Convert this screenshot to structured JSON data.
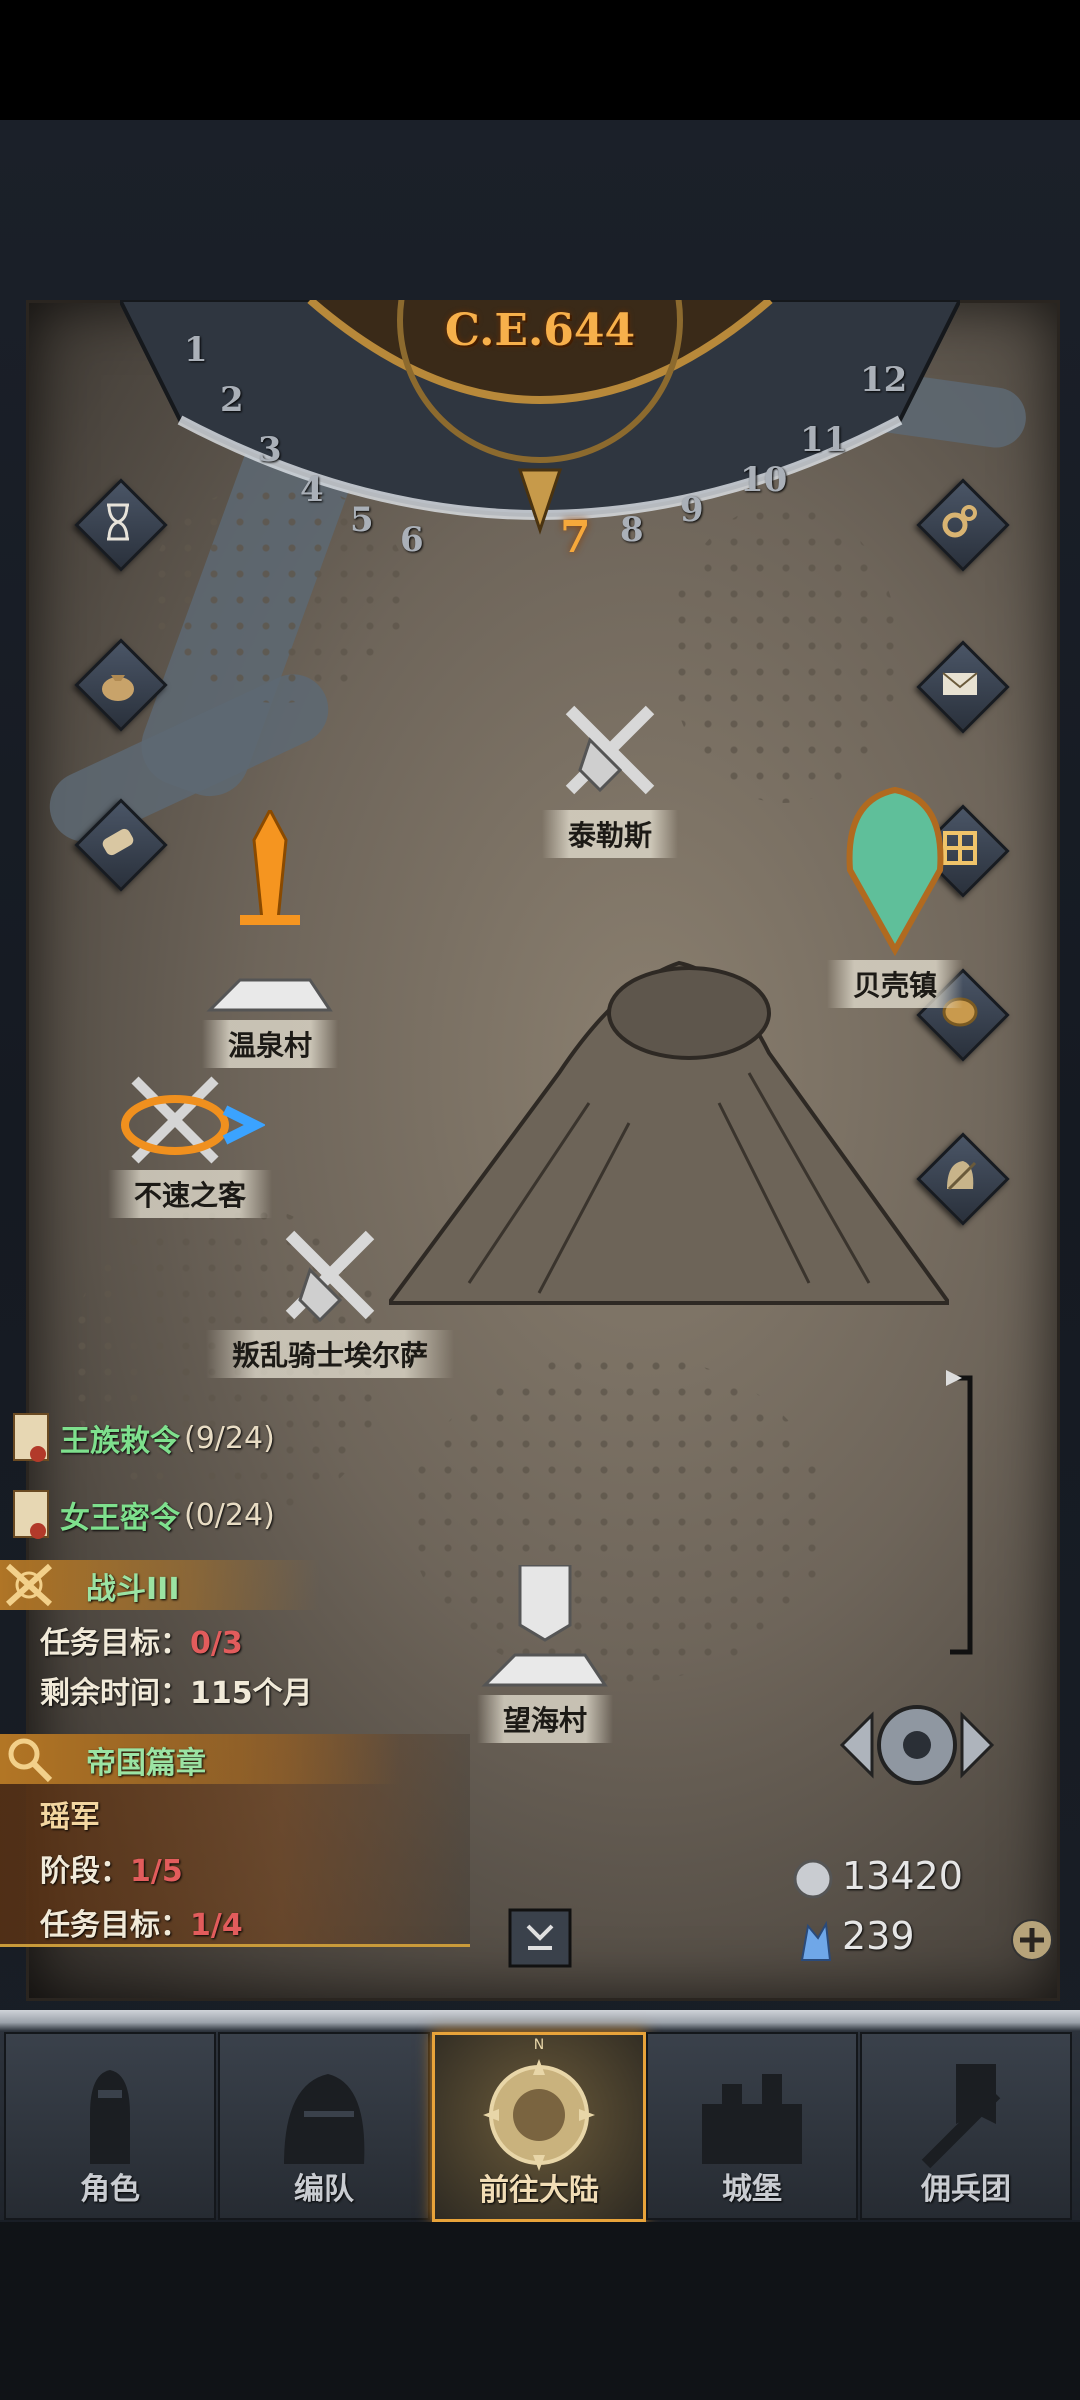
{
  "calendar": {
    "year_label": "C.E.644",
    "months": [
      "1",
      "2",
      "3",
      "4",
      "5",
      "6",
      "7",
      "8",
      "9",
      "10",
      "11",
      "12"
    ],
    "current_month": "7"
  },
  "locations": {
    "tailes": "泰勒斯",
    "hot_spring": "温泉村",
    "shell_town": "贝壳镇",
    "uninvited": "不速之客",
    "rebel_knight": "叛乱骑士埃尔萨",
    "seaview": "望海村"
  },
  "quests": {
    "royal_order": {
      "title": "王族敕令",
      "progress": "(9/24)"
    },
    "queen_order": {
      "title": "女王密令",
      "progress": "(0/24)"
    },
    "battle": {
      "title": "战斗III",
      "goal_label": "任务目标：",
      "goal_value": "0/3",
      "time_label": "剩余时间：",
      "time_value": "115个月"
    },
    "empire": {
      "title": "帝国篇章",
      "subtitle": "瑶军",
      "stage_label": "阶段：",
      "stage_value": "1/5",
      "goal_label": "任务目标：",
      "goal_value": "1/4"
    }
  },
  "currency": {
    "silver": "13420",
    "crystal": "239"
  },
  "nav": {
    "character": "角色",
    "team": "编队",
    "continent": "前往大陆",
    "castle": "城堡",
    "mercenary": "佣兵团",
    "compass_n": "N"
  },
  "colors": {
    "accent_orange": "#e8a33a",
    "quest_green": "#7ee08d",
    "value_red": "#e25c5c"
  }
}
